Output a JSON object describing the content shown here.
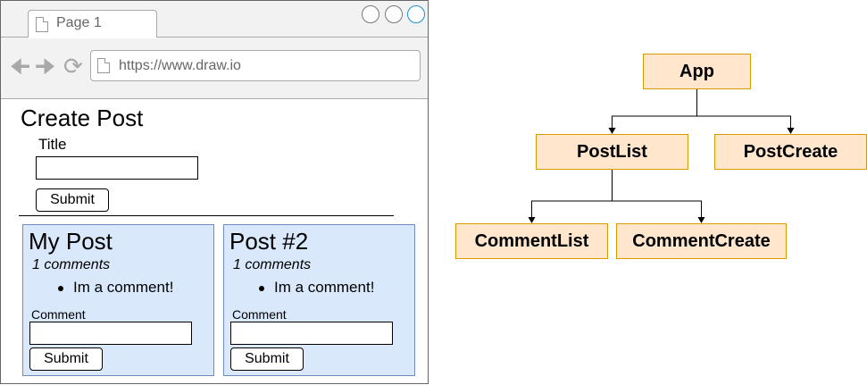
{
  "browser": {
    "tab_label": "Page 1",
    "url": "https://www.draw.io",
    "icons": {
      "back": "arrow-left-icon",
      "forward": "arrow-right-icon",
      "reload": "reload-icon",
      "page": "page-icon"
    }
  },
  "create_post": {
    "heading": "Create Post",
    "title_label": "Title",
    "title_value": "",
    "submit_label": "Submit"
  },
  "posts": [
    {
      "title": "My Post",
      "comment_count": "1 comments",
      "comments": [
        "Im a comment!"
      ],
      "comment_label": "Comment",
      "comment_value": "",
      "submit_label": "Submit"
    },
    {
      "title": "Post #2",
      "comment_count": "1 comments",
      "comments": [
        "Im a comment!"
      ],
      "comment_label": "Comment",
      "comment_value": "",
      "submit_label": "Submit"
    }
  ],
  "tree": {
    "nodes": {
      "app": "App",
      "postlist": "PostList",
      "postcreate": "PostCreate",
      "commentlist": "CommentList",
      "commentcreate": "CommentCreate"
    },
    "edges": [
      [
        "app",
        "postlist"
      ],
      [
        "app",
        "postcreate"
      ],
      [
        "postlist",
        "commentlist"
      ],
      [
        "postlist",
        "commentcreate"
      ]
    ],
    "colors": {
      "fill": "#ffe6cc",
      "stroke": "#d79b00"
    }
  },
  "colors": {
    "card_fill": "#dae8fc",
    "card_stroke": "#6c8ebf",
    "active_window_button": "#1c8fd1"
  }
}
